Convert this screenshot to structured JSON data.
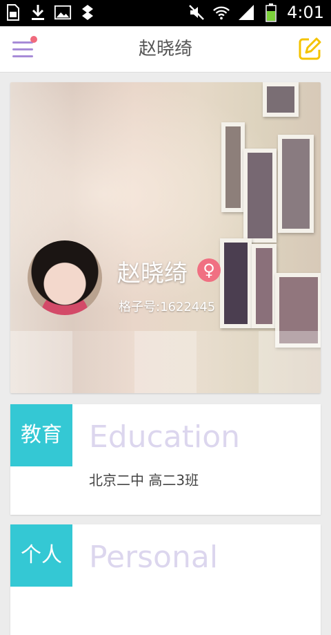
{
  "status_bar": {
    "time": "4:01",
    "icons": [
      "sd-card-icon",
      "download-icon",
      "image-icon",
      "usb-icon",
      "mute-icon",
      "wifi-icon",
      "signal-icon",
      "battery-icon"
    ],
    "battery_color": "#7bd13a"
  },
  "app_bar": {
    "title": "赵晓绮",
    "menu_accent": "#a78bd7",
    "notification_dot_color": "#f06a7d",
    "edit_icon_color": "#f4c300"
  },
  "profile": {
    "name": "赵晓绮",
    "gender_symbol": "♀",
    "id_text": "格子号:1622445",
    "gender_color": "#f07082"
  },
  "cards": [
    {
      "tag": "教育",
      "heading": "Education",
      "detail": "北京二中 高二3班",
      "tag_color": "#34c8d4"
    },
    {
      "tag": "个人",
      "heading": "Personal",
      "detail": "",
      "tag_color": "#34c8d4"
    }
  ]
}
